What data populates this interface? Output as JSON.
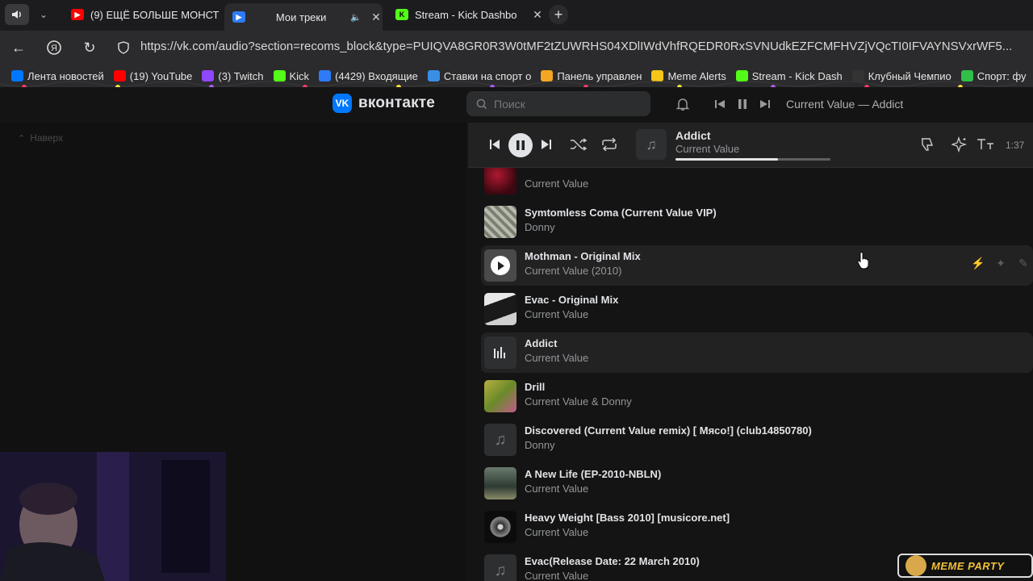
{
  "browser": {
    "tabs": [
      {
        "title": "(9) ЕЩЁ БОЛЬШЕ МОНСТ",
        "favicon": "youtube-icon",
        "color": "#ff0000"
      },
      {
        "title": "Мои треки",
        "favicon": "vk-player-icon",
        "color": "#2d7cf6",
        "active": true
      },
      {
        "title": "Stream - Kick Dashbo",
        "favicon": "kick-icon",
        "color": "#53fc18"
      }
    ],
    "url": "https://vk.com/audio?section=recoms_block&type=PUIQVA8GR0R3W0tMF2tZUWRHS04XDlIWdVhfRQEDR0RxSVNUdkEZFCMFHVZjVQcTI0IFVAYNSVxrWF5..."
  },
  "bookmarks": [
    {
      "label": "Лента новостей",
      "icon": "vk-icon",
      "color": "#0077ff"
    },
    {
      "label": "(19) YouTube",
      "icon": "youtube-icon",
      "color": "#ff0000"
    },
    {
      "label": "(3) Twitch",
      "icon": "twitch-icon",
      "color": "#9146ff"
    },
    {
      "label": "Kick",
      "icon": "kick-icon",
      "color": "#53fc18"
    },
    {
      "label": "(4429) Входящие",
      "icon": "mail-icon",
      "color": "#2d7cf6"
    },
    {
      "label": "Ставки на спорт о",
      "icon": "betting-icon",
      "color": "#3a8ee6"
    },
    {
      "label": "Панель управлен",
      "icon": "donation-icon",
      "color": "#f5a623"
    },
    {
      "label": "Meme Alerts",
      "icon": "meme-alerts-icon",
      "color": "#f5c518"
    },
    {
      "label": "Stream - Kick Dash",
      "icon": "kick-icon",
      "color": "#53fc18"
    },
    {
      "label": "Клубный Чемпио",
      "icon": "club-icon",
      "color": "#333333"
    },
    {
      "label": "Спорт: фу",
      "icon": "sport-icon",
      "color": "#2fbf4a"
    }
  ],
  "vk": {
    "logo_text": "вконтакте",
    "search_placeholder": "Поиск",
    "header_now_playing": "Current Value — Addict",
    "scroll_top_label": "Наверх"
  },
  "player": {
    "title": "Addict",
    "artist": "Current Value",
    "time": "1:37",
    "progress": 0.66,
    "buffered": 1.0
  },
  "tracks": [
    {
      "title": "",
      "artist": "Current Value",
      "cover": "red-art"
    },
    {
      "title": "Symtomless Coma (Current Value VIP)",
      "artist": "Donny",
      "cover": "grey-art"
    },
    {
      "title": "Mothman - Original Mix",
      "artist": "Current Value (2010)",
      "cover": "play-overlay",
      "state": "hover"
    },
    {
      "title": "Evac - Original Mix",
      "artist": "Current Value",
      "cover": "dark-art"
    },
    {
      "title": "Addict",
      "artist": "Current Value",
      "cover": "equalizer",
      "state": "playing"
    },
    {
      "title": "Drill",
      "artist": "Current Value & Donny",
      "cover": "green-art"
    },
    {
      "title": "Discovered (Current Value remix) [ Мясо!] (club14850780)",
      "artist": "Donny",
      "cover": "note"
    },
    {
      "title": "A New Life (EP-2010-NBLN)",
      "artist": "Current Value",
      "cover": "forest-art"
    },
    {
      "title": "Heavy Weight [Bass 2010] [musicore.net]",
      "artist": "Current Value",
      "cover": "disc-art"
    },
    {
      "title": "Evac(Release Date: 22 March 2010)",
      "artist": "Current Value",
      "cover": "note"
    }
  ],
  "overlay": {
    "meme_party": "MEME PARTY"
  }
}
